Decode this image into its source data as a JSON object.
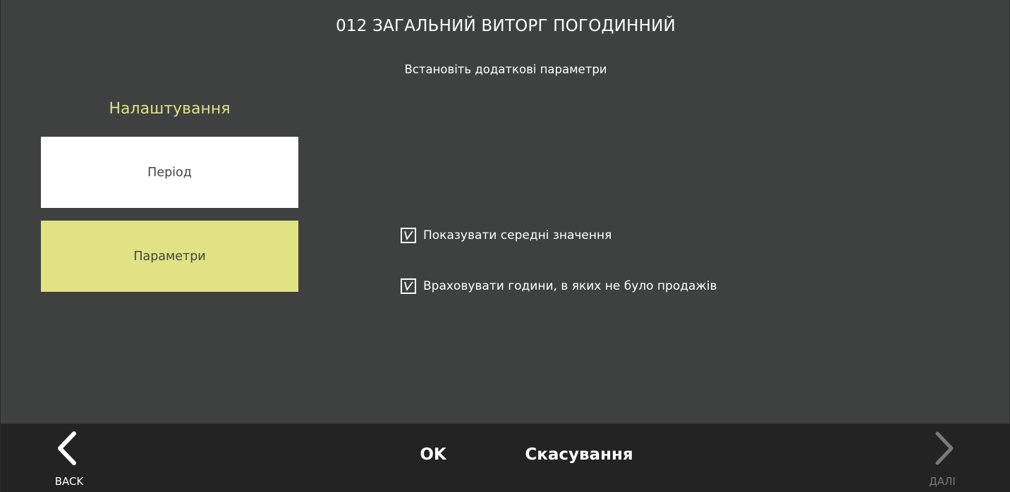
{
  "header": {
    "title": "012 ЗАГАЛЬНИЙ ВИТОРГ ПОГОДИННИЙ",
    "subtitle": "Встановіть додаткові параметри"
  },
  "sidebar": {
    "heading": "Налаштування",
    "items": [
      {
        "label": "Період",
        "selected": false
      },
      {
        "label": "Параметри",
        "selected": true
      }
    ]
  },
  "options": [
    {
      "label": "Показувати середні значення",
      "checked": true
    },
    {
      "label": "Враховувати години, в яких не було продажів",
      "checked": true
    }
  ],
  "footer": {
    "back_label": "BACK",
    "ok_label": "OK",
    "cancel_label": "Скасування",
    "next_label": "ДАЛІ"
  },
  "colors": {
    "background": "#3f4140",
    "accent": "#e0e283",
    "footer": "#232323",
    "disabled": "#7a7a7a"
  }
}
